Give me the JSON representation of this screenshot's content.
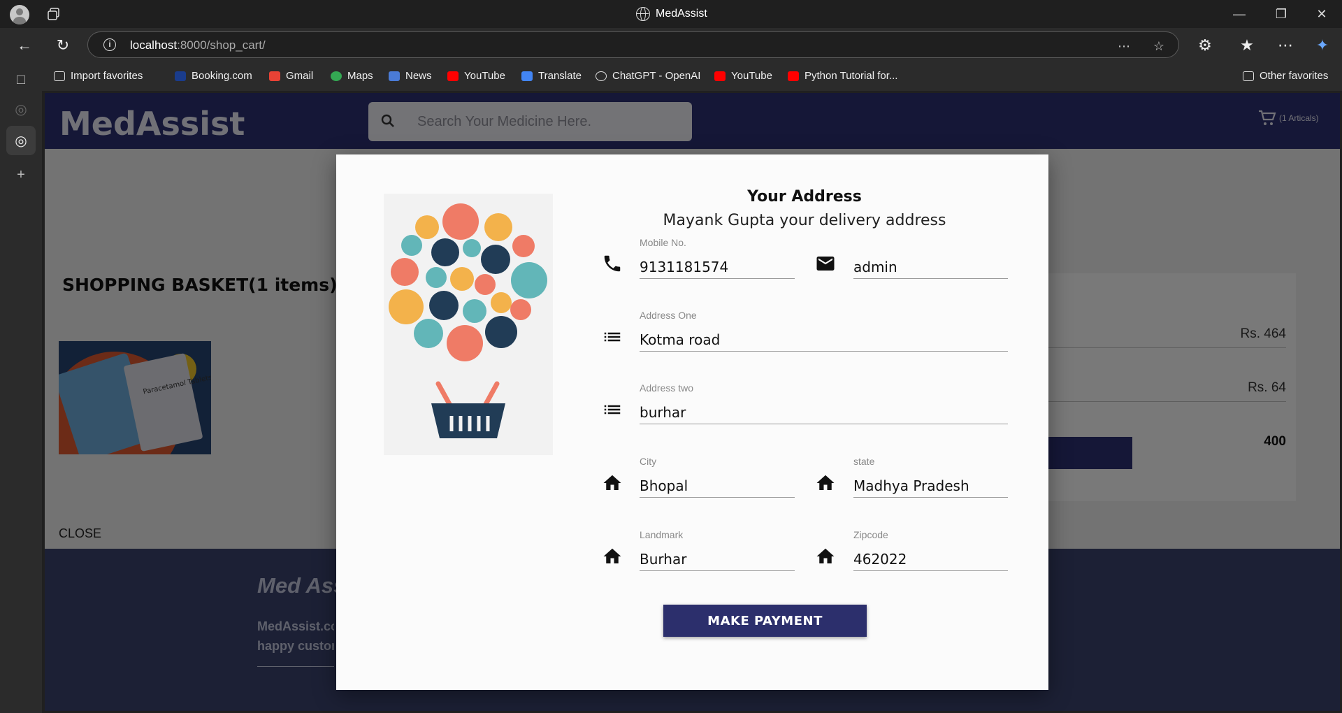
{
  "browser": {
    "window_title": "MedAssist",
    "url_host": "localhost",
    "url_rest": ":8000/shop_cart/",
    "favorites": [
      {
        "label": "Import favorites",
        "icon": "import-icon"
      },
      {
        "label": "Booking.com",
        "icon": "booking-icon"
      },
      {
        "label": "Gmail",
        "icon": "gmail-icon"
      },
      {
        "label": "Maps",
        "icon": "maps-icon"
      },
      {
        "label": "News",
        "icon": "news-icon"
      },
      {
        "label": "YouTube",
        "icon": "youtube-icon"
      },
      {
        "label": "Translate",
        "icon": "translate-icon"
      },
      {
        "label": "ChatGPT - OpenAI",
        "icon": "chatgpt-icon"
      },
      {
        "label": "YouTube",
        "icon": "youtube-icon"
      },
      {
        "label": "Python Tutorial for...",
        "icon": "youtube-icon"
      }
    ],
    "other_favorites": "Other favorites"
  },
  "site": {
    "brand": "MedAssist",
    "search_placeholder": "Search Your Medicine Here.",
    "cart_label": "(1 Articals)",
    "accent": "#2b2f6e"
  },
  "basket": {
    "title": "SHOPPING BASKET(1 items)",
    "product_image_text": "Paracetamol Tablets IP",
    "prices": [
      "Rs. 464",
      "Rs. 64",
      "400"
    ],
    "close": "CLOSE"
  },
  "footer": {
    "title": "Med Ass",
    "line1": "MedAssist.co",
    "line2": "happy custor"
  },
  "modal": {
    "title": "Your Address",
    "subtitle": "Mayank Gupta your delivery address",
    "fields": {
      "mobile": {
        "label": "Mobile No.",
        "value": "9131181574"
      },
      "email": {
        "label": "",
        "value": "admin"
      },
      "address1": {
        "label": "Address One",
        "value": "Kotma road"
      },
      "address2": {
        "label": "Address two",
        "value": "burhar"
      },
      "city": {
        "label": "City",
        "value": "Bhopal"
      },
      "state": {
        "label": "state",
        "value": "Madhya Pradesh"
      },
      "landmark": {
        "label": "Landmark",
        "value": "Burhar"
      },
      "zipcode": {
        "label": "Zipcode",
        "value": "462022"
      }
    },
    "pay_button": "MAKE PAYMENT"
  }
}
